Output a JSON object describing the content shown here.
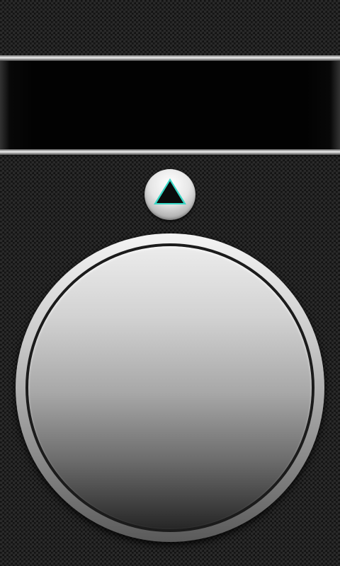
{
  "display": {
    "text": ""
  },
  "mode_button": {
    "icon": "triangle-up-icon",
    "accent_color": "#39d8c6"
  },
  "push_button": {
    "style": "brushed-metal"
  }
}
